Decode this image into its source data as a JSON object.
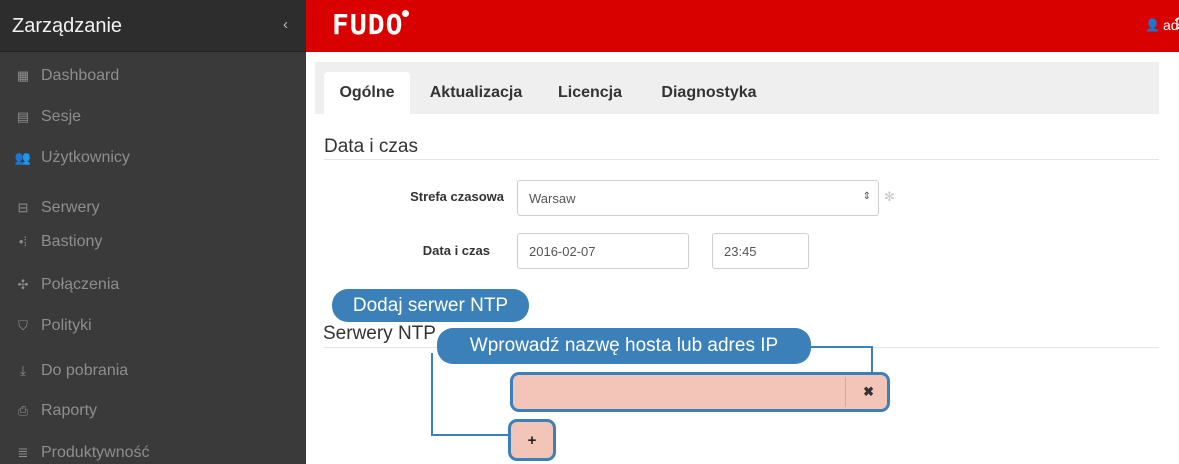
{
  "sidebar": {
    "title": "Zarządzanie",
    "collapse_glyph": "‹",
    "items": [
      {
        "label": "Dashboard",
        "icon": "dashboard-icon",
        "glyph": "▦"
      },
      {
        "label": "Sesje",
        "icon": "film-icon",
        "glyph": "▤"
      },
      {
        "label": "Użytkownicy",
        "icon": "users-icon",
        "glyph": "👥"
      },
      {
        "label": "Serwery",
        "icon": "server-icon",
        "glyph": "⊟"
      },
      {
        "label": "Bastiony",
        "icon": "bastion-icon",
        "glyph": "•⁞"
      },
      {
        "label": "Połączenia",
        "icon": "connections-icon",
        "glyph": "✣"
      },
      {
        "label": "Polityki",
        "icon": "shield-icon",
        "glyph": "⛉"
      },
      {
        "label": "Do pobrania",
        "icon": "download-icon",
        "glyph": "⤓"
      },
      {
        "label": "Raporty",
        "icon": "print-icon",
        "glyph": "⎙"
      },
      {
        "label": "Produktywność",
        "icon": "bars-icon",
        "glyph": "≣"
      }
    ]
  },
  "topbar": {
    "logo": "FUDO",
    "user": "admin",
    "user_glyph": "👤",
    "caret_glyph": "⌄",
    "help_glyph": "?"
  },
  "tabs": [
    {
      "label": "Ogólne",
      "active": true
    },
    {
      "label": "Aktualizacja",
      "active": false
    },
    {
      "label": "Licencja",
      "active": false
    },
    {
      "label": "Diagnostyka",
      "active": false
    }
  ],
  "datetime_section": {
    "title": "Data i czas",
    "timezone_label": "Strefa czasowa",
    "timezone_value": "Warsaw",
    "select_arrows": "⇕",
    "cog_glyph": "✻",
    "datetime_label": "Data i czas",
    "date_value": "2016-02-07",
    "time_value": "23:45"
  },
  "ntp_section": {
    "title": "Serwery NTP",
    "host_value": "",
    "clear_glyph": "✖",
    "add_glyph": "+"
  },
  "callouts": {
    "add_ntp": "Dodaj serwer NTP",
    "enter_host": "Wprowadź nazwę hosta lub adres IP"
  },
  "colors": {
    "brand_red": "#d90000",
    "sidebar_bg": "#3a3a3a",
    "callout_blue": "#3b80b8",
    "highlight_fill": "#f2c5b8"
  }
}
